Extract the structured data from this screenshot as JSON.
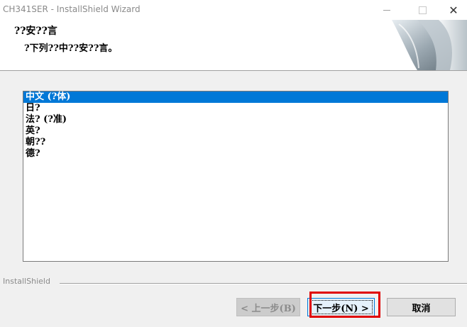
{
  "window": {
    "title": "CH341SER - InstallShield Wizard",
    "minimize_glyph": "",
    "maximize_glyph": "",
    "close_glyph": "✕"
  },
  "header": {
    "title": "??安??言",
    "subtitle": "?下列??中??安??言。"
  },
  "language_list": {
    "items": [
      {
        "label": "中文 (?体)",
        "selected": true
      },
      {
        "label": "日?",
        "selected": false
      },
      {
        "label": "法? (?准)",
        "selected": false
      },
      {
        "label": "英?",
        "selected": false
      },
      {
        "label": "朝??",
        "selected": false
      },
      {
        "label": "德?",
        "selected": false
      }
    ]
  },
  "footer": {
    "brand": "InstallShield",
    "back_label": "< 上一步(B)",
    "next_label": "下一步(N) >",
    "cancel_label": "取消"
  },
  "colors": {
    "selection": "#0078d7",
    "highlight_box": "#e00000"
  }
}
